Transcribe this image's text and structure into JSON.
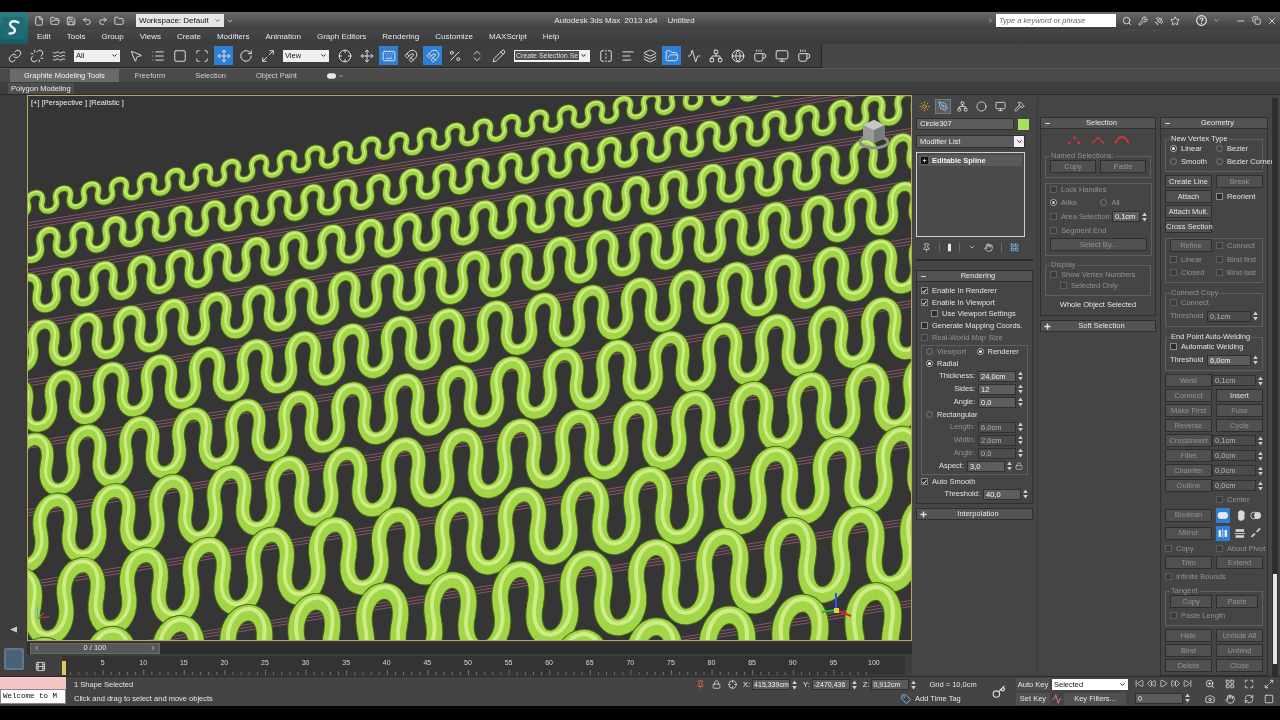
{
  "title_bar": {
    "workspace": "Workspace: Default",
    "app_title": "Autodesk 3ds Max  2013 x64",
    "document": "Untitled",
    "search": {
      "placeholder": "Type a keyword or phrase"
    }
  },
  "menu_bar": [
    "Edit",
    "Tools",
    "Group",
    "Views",
    "Create",
    "Modifiers",
    "Animation",
    "Graph Editors",
    "Rendering",
    "Customize",
    "MAXScript",
    "Help"
  ],
  "main_toolbar": [
    {
      "kind": "link",
      "selected": false
    },
    {
      "kind": "unlink",
      "selected": false
    },
    {
      "kind": "bind",
      "selected": false
    },
    {
      "kind": "dropdown",
      "value": "All"
    },
    {
      "kind": "select",
      "selected": false
    },
    {
      "kind": "select_by_name",
      "selected": false
    },
    {
      "kind": "region",
      "selected": false
    },
    {
      "kind": "crossing",
      "selected": false
    },
    {
      "kind": "move",
      "selected": true
    },
    {
      "kind": "rotate",
      "selected": false
    },
    {
      "kind": "scale",
      "selected": false
    },
    {
      "kind": "dropdown",
      "value": "View"
    },
    {
      "kind": "pivot",
      "selected": false
    },
    {
      "kind": "manipulate",
      "selected": false
    },
    {
      "kind": "keyboard",
      "selected": true
    },
    {
      "kind": "snap",
      "selected": false
    },
    {
      "kind": "angle_snap",
      "selected": true
    },
    {
      "kind": "percent_snap",
      "selected": false
    },
    {
      "kind": "spinner_snap",
      "selected": false
    },
    {
      "kind": "edit_sets",
      "selected": false
    },
    {
      "kind": "field",
      "placeholder": "Create Selection Se"
    },
    {
      "kind": "mirror",
      "selected": false
    },
    {
      "kind": "align",
      "selected": false
    },
    {
      "kind": "layers",
      "selected": false
    },
    {
      "kind": "explorer",
      "selected": true
    },
    {
      "kind": "curve_editor",
      "selected": false
    },
    {
      "kind": "schematic",
      "selected": false
    },
    {
      "kind": "material",
      "selected": false
    },
    {
      "kind": "render_setup",
      "selected": false
    },
    {
      "kind": "frame_window",
      "selected": false
    },
    {
      "kind": "render",
      "selected": false
    }
  ],
  "ribbon": {
    "tabs": [
      {
        "label": "Graphite Modeling Tools",
        "selected": true
      },
      {
        "label": "Freeform",
        "selected": false
      },
      {
        "label": "Selection",
        "selected": false
      },
      {
        "label": "Object Paint",
        "selected": false
      }
    ],
    "panel": "Polygon Modeling"
  },
  "viewport": {
    "label": "[+] [Perspective ] [Realistic ]"
  },
  "command_panel": {
    "tabs": [
      {
        "kind": "create",
        "selected": false
      },
      {
        "kind": "modify",
        "selected": true
      },
      {
        "kind": "hierarchy",
        "selected": false
      },
      {
        "kind": "motion",
        "selected": false
      },
      {
        "kind": "display",
        "selected": false
      },
      {
        "kind": "utilities",
        "selected": false
      }
    ],
    "object_name": "Circle307",
    "modifier_list": "Modifier List",
    "modifier_stack": [
      {
        "label": "Editable Spline"
      }
    ],
    "rollouts": [
      [
        {
          "title": "Rendering",
          "expanded": true,
          "rows": [
            {
              "kind": "checkbox",
              "label": "Enable In Renderer",
              "checked": true,
              "disabled": false
            },
            {
              "kind": "checkbox",
              "label": "Enable In Viewport",
              "checked": true,
              "disabled": false,
              "children": [
                {
                  "kind": "checkbox",
                  "label": "Use Viewport Settings",
                  "checked": false,
                  "disabled": false
                }
              ]
            },
            {
              "kind": "checkbox",
              "label": "Generate Mapping Coords.",
              "checked": false,
              "disabled": false
            },
            {
              "kind": "checkbox",
              "label": "Real-World Map Size",
              "checked": false,
              "disabled": true
            },
            {
              "kind": "group",
              "rows": [
                {
                  "kind": "row",
                  "items": [
                    {
                      "kind": "radio",
                      "label": "Viewport",
                      "selected": false,
                      "disabled": true
                    },
                    {
                      "kind": "radio",
                      "label": "Renderer",
                      "selected": true,
                      "disabled": false
                    }
                  ]
                },
                {
                  "kind": "radio",
                  "label": "Radial",
                  "selected": true,
                  "disabled": false
                },
                {
                  "kind": "spinner",
                  "label": "Thickness:",
                  "value": "24,0cm",
                  "disabled": false
                },
                {
                  "kind": "spinner",
                  "label": "Sides:",
                  "value": "12",
                  "disabled": false
                },
                {
                  "kind": "spinner",
                  "label": "Angle:",
                  "value": "0,0",
                  "disabled": false
                },
                {
                  "kind": "radio",
                  "label": "Rectangular",
                  "selected": false,
                  "disabled": false
                },
                {
                  "kind": "spinner",
                  "label": "Length:",
                  "value": "6,0cm",
                  "disabled": true
                },
                {
                  "kind": "spinner",
                  "label": "Width:",
                  "value": "2,0cm",
                  "disabled": true
                },
                {
                  "kind": "spinner",
                  "label": "Angle:",
                  "value": "0,0",
                  "disabled": true
                },
                {
                  "kind": "spinner",
                  "label": "Aspect:",
                  "value": "3,0",
                  "disabled": false,
                  "lock": true
                }
              ]
            },
            {
              "kind": "checkbox",
              "label": "Auto Smooth",
              "checked": true,
              "disabled": false
            },
            {
              "kind": "spinner",
              "label": "Threshold:",
              "value": "40,0",
              "disabled": false
            }
          ]
        },
        {
          "title": "Interpolation",
          "expanded": false
        }
      ],
      [
        {
          "title": "Selection",
          "expanded": true,
          "rows": [
            {
              "kind": "subobjects",
              "items": [
                {
                  "kind": "vertex",
                  "selected": false
                },
                {
                  "kind": "segment",
                  "selected": false
                },
                {
                  "kind": "spline",
                  "selected": false
                }
              ]
            },
            {
              "kind": "group",
              "label": "Named Selections:",
              "disabled": true,
              "rows": [
                {
                  "kind": "row",
                  "items": [
                    {
                      "kind": "button",
                      "label": "Copy",
                      "disabled": true
                    },
                    {
                      "kind": "button",
                      "label": "Paste",
                      "disabled": true
                    }
                  ]
                }
              ]
            },
            {
              "kind": "group",
              "rows": [
                {
                  "kind": "checkbox",
                  "label": "Lock Handles",
                  "checked": false,
                  "disabled": true
                },
                {
                  "kind": "row",
                  "items": [
                    {
                      "kind": "radio",
                      "label": "Alike",
                      "selected": true,
                      "disabled": true
                    },
                    {
                      "kind": "radio",
                      "label": "All",
                      "selected": false,
                      "disabled": true
                    }
                  ]
                },
                {
                  "kind": "row",
                  "items": [
                    {
                      "kind": "checkbox",
                      "label": "Area Selection:",
                      "checked": false,
                      "disabled": true
                    },
                    {
                      "kind": "field",
                      "value": "0,1cm",
                      "disabled": false
                    }
                  ]
                },
                {
                  "kind": "checkbox",
                  "label": "Segment End",
                  "checked": false,
                  "disabled": true
                },
                {
                  "kind": "button",
                  "label": "Select By...",
                  "disabled": true
                }
              ]
            },
            {
              "kind": "group",
              "label": "Display",
              "disabled": true,
              "rows": [
                {
                  "kind": "checkbox",
                  "label": "Show Vertex Numbers",
                  "checked": false,
                  "disabled": true,
                  "children": [
                    {
                      "kind": "checkbox",
                      "label": "Selected Only",
                      "checked": false,
                      "disabled": true
                    }
                  ]
                }
              ]
            },
            {
              "kind": "text",
              "text": "Whole Object Selected"
            }
          ]
        },
        {
          "title": "Soft Selection",
          "expanded": false
        }
      ],
      [
        {
          "title": "Geometry",
          "expanded": true,
          "rows": [
            {
              "kind": "group",
              "label": "New Vertex Type",
              "disabled": false,
              "rows": [
                {
                  "kind": "row",
                  "items": [
                    {
                      "kind": "radio",
                      "label": "Linear",
                      "selected": true,
                      "disabled": false
                    },
                    {
                      "kind": "radio",
                      "label": "Bezier",
                      "selected": false,
                      "disabled": false
                    }
                  ]
                },
                {
                  "kind": "row",
                  "items": [
                    {
                      "kind": "radio",
                      "label": "Smooth",
                      "selected": false,
                      "disabled": false
                    },
                    {
                      "kind": "radio",
                      "label": "Bezier Corner",
                      "selected": false,
                      "disabled": false
                    }
                  ]
                }
              ]
            },
            {
              "kind": "row",
              "items": [
                {
                  "kind": "button",
                  "label": "Create Line",
                  "disabled": false
                },
                {
                  "kind": "button",
                  "label": "Break",
                  "disabled": true
                }
              ]
            },
            {
              "kind": "row",
              "items": [
                {
                  "kind": "button",
                  "label": "Attach",
                  "disabled": false
                },
                {
                  "kind": "checkbox",
                  "label": "Reorient",
                  "checked": false,
                  "disabled": false
                }
              ]
            },
            {
              "kind": "row",
              "items": [
                {
                  "kind": "button",
                  "label": "Attach Mult.",
                  "disabled": false
                }
              ]
            },
            {
              "kind": "row",
              "items": [
                {
                  "kind": "button",
                  "label": "Cross Section",
                  "disabled": false
                }
              ]
            },
            {
              "kind": "group",
              "rows": [
                {
                  "kind": "row",
                  "items": [
                    {
                      "kind": "button",
                      "label": "Refine",
                      "disabled": true
                    },
                    {
                      "kind": "checkbox",
                      "label": "Connect",
                      "checked": false,
                      "disabled": true
                    }
                  ]
                },
                {
                  "kind": "row",
                  "items": [
                    {
                      "kind": "checkbox",
                      "label": "Linear",
                      "checked": false,
                      "disabled": true
                    },
                    {
                      "kind": "checkbox",
                      "label": "Bind first",
                      "checked": false,
                      "disabled": true
                    }
                  ]
                },
                {
                  "kind": "row",
                  "items": [
                    {
                      "kind": "checkbox",
                      "label": "Closed",
                      "checked": false,
                      "disabled": true
                    },
                    {
                      "kind": "checkbox",
                      "label": "Bind last",
                      "checked": false,
                      "disabled": true
                    }
                  ]
                }
              ]
            },
            {
              "kind": "group",
              "label": "Connect Copy",
              "disabled": true,
              "rows": [
                {
                  "kind": "checkbox",
                  "label": "Connect",
                  "checked": false,
                  "disabled": true
                },
                {
                  "kind": "spinner",
                  "label": "Threshold",
                  "value": "0,1cm",
                  "disabled": true
                }
              ]
            },
            {
              "kind": "group",
              "label": "End Point Auto-Welding",
              "disabled": false,
              "rows": [
                {
                  "kind": "checkbox",
                  "label": "Automatic Welding",
                  "checked": false,
                  "disabled": false
                },
                {
                  "kind": "spinner",
                  "label": "Threshold",
                  "value": "6,0cm",
                  "disabled": false
                }
              ]
            },
            {
              "kind": "row",
              "items": [
                {
                  "kind": "button",
                  "label": "Weld",
                  "disabled": true
                },
                {
                  "kind": "field",
                  "value": "0,1cm",
                  "disabled": true
                }
              ]
            },
            {
              "kind": "row",
              "items": [
                {
                  "kind": "button",
                  "label": "Connect",
                  "disabled": true
                },
                {
                  "kind": "button",
                  "label": "Insert",
                  "disabled": false
                }
              ]
            },
            {
              "kind": "row",
              "items": [
                {
                  "kind": "button",
                  "label": "Make First",
                  "disabled": true
                },
                {
                  "kind": "button",
                  "label": "Fuse",
                  "disabled": true
                }
              ]
            },
            {
              "kind": "row",
              "items": [
                {
                  "kind": "button",
                  "label": "Reverse",
                  "disabled": true
                },
                {
                  "kind": "button",
                  "label": "Cycle",
                  "disabled": true
                }
              ]
            },
            {
              "kind": "row",
              "items": [
                {
                  "kind": "button",
                  "label": "CrossInsert",
                  "disabled": true
                },
                {
                  "kind": "field",
                  "value": "0,1cm",
                  "disabled": true
                }
              ]
            },
            {
              "kind": "row",
              "items": [
                {
                  "kind": "button",
                  "label": "Fillet",
                  "disabled": true
                },
                {
                  "kind": "field",
                  "value": "0,0cm",
                  "disabled": true
                }
              ]
            },
            {
              "kind": "row",
              "items": [
                {
                  "kind": "button",
                  "label": "Chamfer",
                  "disabled": true
                },
                {
                  "kind": "field",
                  "value": "0,0cm",
                  "disabled": true
                }
              ]
            },
            {
              "kind": "row",
              "items": [
                {
                  "kind": "button",
                  "label": "Outline",
                  "disabled": true
                },
                {
                  "kind": "field",
                  "value": "0,0cm",
                  "disabled": true
                }
              ]
            },
            {
              "kind": "row",
              "items": [
                {
                  "kind": "checkbox",
                  "label": "Center",
                  "checked": false,
                  "disabled": true
                }
              ]
            },
            {
              "kind": "row",
              "items": [
                {
                  "kind": "button",
                  "label": "Boolean",
                  "disabled": true
                },
                {
                  "kind": "ops",
                  "items": [
                    {
                      "kind": "union",
                      "selected": true
                    },
                    {
                      "kind": "subtract",
                      "selected": false
                    },
                    {
                      "kind": "intersect",
                      "selected": false
                    }
                  ]
                }
              ]
            },
            {
              "kind": "row",
              "items": [
                {
                  "kind": "button",
                  "label": "Mirror",
                  "disabled": true
                },
                {
                  "kind": "ops",
                  "items": [
                    {
                      "kind": "mirror_h",
                      "selected": true
                    },
                    {
                      "kind": "mirror_v",
                      "selected": false
                    },
                    {
                      "kind": "mirror_both",
                      "selected": false
                    }
                  ]
                }
              ]
            },
            {
              "kind": "row",
              "items": [
                {
                  "kind": "checkbox",
                  "label": "Copy",
                  "checked": false,
                  "disabled": true
                },
                {
                  "kind": "checkbox",
                  "label": "About Pivot",
                  "checked": false,
                  "disabled": true
                }
              ]
            },
            {
              "kind": "row",
              "items": [
                {
                  "kind": "button",
                  "label": "Trim",
                  "disabled": true
                },
                {
                  "kind": "button",
                  "label": "Extend",
                  "disabled": true
                }
              ]
            },
            {
              "kind": "checkbox",
              "label": "Infinite Bounds",
              "checked": false,
              "disabled": true
            },
            {
              "kind": "group",
              "label": "Tangent",
              "disabled": true,
              "rows": [
                {
                  "kind": "row",
                  "items": [
                    {
                      "kind": "button",
                      "label": "Copy",
                      "disabled": true
                    },
                    {
                      "kind": "button",
                      "label": "Paste",
                      "disabled": true
                    }
                  ]
                },
                {
                  "kind": "checkbox",
                  "label": "Paste Length",
                  "checked": false,
                  "disabled": true
                }
              ]
            },
            {
              "kind": "row",
              "items": [
                {
                  "kind": "button",
                  "label": "Hide",
                  "disabled": true
                },
                {
                  "kind": "button",
                  "label": "Unhide All",
                  "disabled": true
                }
              ]
            },
            {
              "kind": "row",
              "items": [
                {
                  "kind": "button",
                  "label": "Bind",
                  "disabled": true
                },
                {
                  "kind": "button",
                  "label": "Unbind",
                  "disabled": true
                }
              ]
            },
            {
              "kind": "row",
              "items": [
                {
                  "kind": "button",
                  "label": "Delete",
                  "disabled": true
                },
                {
                  "kind": "button",
                  "label": "Close",
                  "disabled": true
                }
              ]
            }
          ]
        }
      ]
    ]
  },
  "timeline": {
    "position": "0 / 100",
    "ruler": [
      "5",
      "10",
      "15",
      "20",
      "25",
      "30",
      "35",
      "40",
      "45",
      "50",
      "55",
      "60",
      "65",
      "70",
      "75",
      "80",
      "85",
      "90",
      "95",
      "100"
    ]
  },
  "status_bar": {
    "listener": {
      "value": "Welcome to M"
    },
    "selection_info": "1 Shape Selected",
    "prompt": "Click and drag to select and move objects",
    "coordinates": [
      {
        "axis": "X:",
        "value": "415,339cm"
      },
      {
        "axis": "Y:",
        "value": "-2470,436"
      },
      {
        "axis": "Z:",
        "value": "0,912cm"
      }
    ],
    "grid": "Grid = 10,0cm",
    "time_tag": "Add Time Tag",
    "auto_key": {
      "label": "Auto Key",
      "selected": false
    },
    "key_mode": "Selected",
    "set_key": {
      "label": "Set Key",
      "selected": false
    },
    "key_filters": "Key Filters...",
    "current_frame": "0"
  }
}
